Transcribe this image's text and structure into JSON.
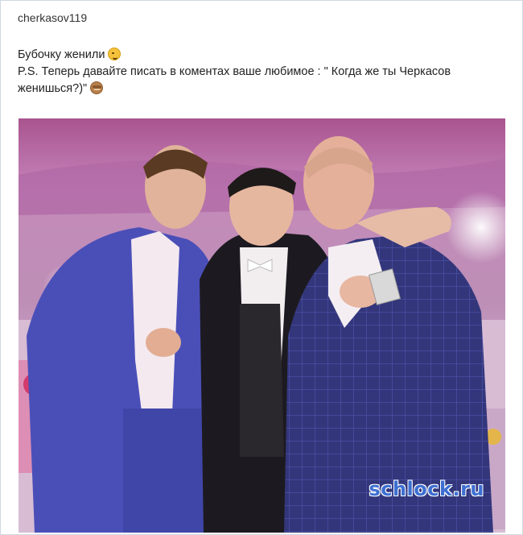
{
  "post": {
    "username": "cherkasov119",
    "text_line1": "Бубочку женили",
    "text_line2": "P.S. Теперь давайте писать в коментах ваше любимое : \" Когда же ты Черкасов",
    "text_line3": "женишься?)\"",
    "emoji1": "winking-face-emoji",
    "emoji2": "see-no-evil-monkey-emoji"
  },
  "photo": {
    "description_icon": "group-photo",
    "watermark": "schlock.ru"
  },
  "colors": {
    "watermark": "#3d6fd1",
    "border": "#cfd8e0",
    "suit_left": "#4a4fb8",
    "suit_right": "#2f3070"
  }
}
